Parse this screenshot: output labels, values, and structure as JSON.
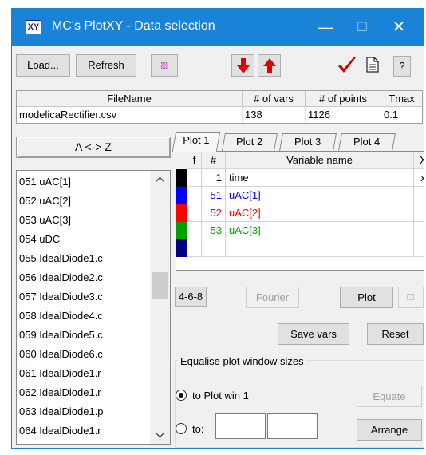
{
  "window": {
    "app_icon_text": "XY",
    "title": "MC's PlotXY - Data selection",
    "controls": {
      "minimize": "—",
      "maximize": "☐",
      "close": "✕"
    },
    "accent": "#1883d7"
  },
  "toolbar": {
    "load_label": "Load...",
    "refresh_label": "Refresh",
    "help_label": "?"
  },
  "file_grid": {
    "headers": [
      "FileName",
      "# of vars",
      "# of points",
      "Tmax"
    ],
    "row": [
      "modelicaRectifier.csv",
      "138",
      "1126",
      "0.1"
    ]
  },
  "sort_button": "A <-> Z",
  "variable_list": [
    "051  uAC[1]",
    "052  uAC[2]",
    "053  uAC[3]",
    "054  uDC",
    "055  IdealDiode1.c",
    "056  IdealDiode2.c",
    "057  IdealDiode3.c",
    "058  IdealDiode4.c",
    "059  IdealDiode5.c",
    "060  IdealDiode6.c",
    "061  IdealDiode1.r",
    "062  IdealDiode1.r",
    "063  IdealDiode1.p",
    "064  IdealDiode1.r"
  ],
  "plot_tabs": [
    "Plot 1",
    "Plot 2",
    "Plot 3",
    "Plot 4"
  ],
  "plot_table": {
    "headers": {
      "f": "f",
      "num": "#",
      "name": "Variable name",
      "x": "X"
    },
    "rows": [
      {
        "color": "#000000",
        "num": "1",
        "name": "time",
        "x": "x",
        "text_color": "#000000"
      },
      {
        "color": "#0000ff",
        "num": "51",
        "name": "uAC[1]",
        "x": "",
        "text_color": "#0000ff"
      },
      {
        "color": "#ff0000",
        "num": "52",
        "name": "uAC[2]",
        "x": "",
        "text_color": "#ff0000"
      },
      {
        "color": "#00a000",
        "num": "53",
        "name": "uAC[3]",
        "x": "",
        "text_color": "#00a000"
      },
      {
        "color": "#000080",
        "num": "",
        "name": "",
        "x": "",
        "text_color": "#000000"
      }
    ]
  },
  "buttons": {
    "four_six_eight": "4-6-8",
    "fourier": "Fourier",
    "plot": "Plot",
    "save_vars": "Save vars",
    "reset": "Reset",
    "equate": "Equate",
    "arrange": "Arrange"
  },
  "equalise": {
    "title": "Equalise plot window sizes",
    "option_plot_win": "to Plot win 1",
    "option_to": "to:"
  }
}
